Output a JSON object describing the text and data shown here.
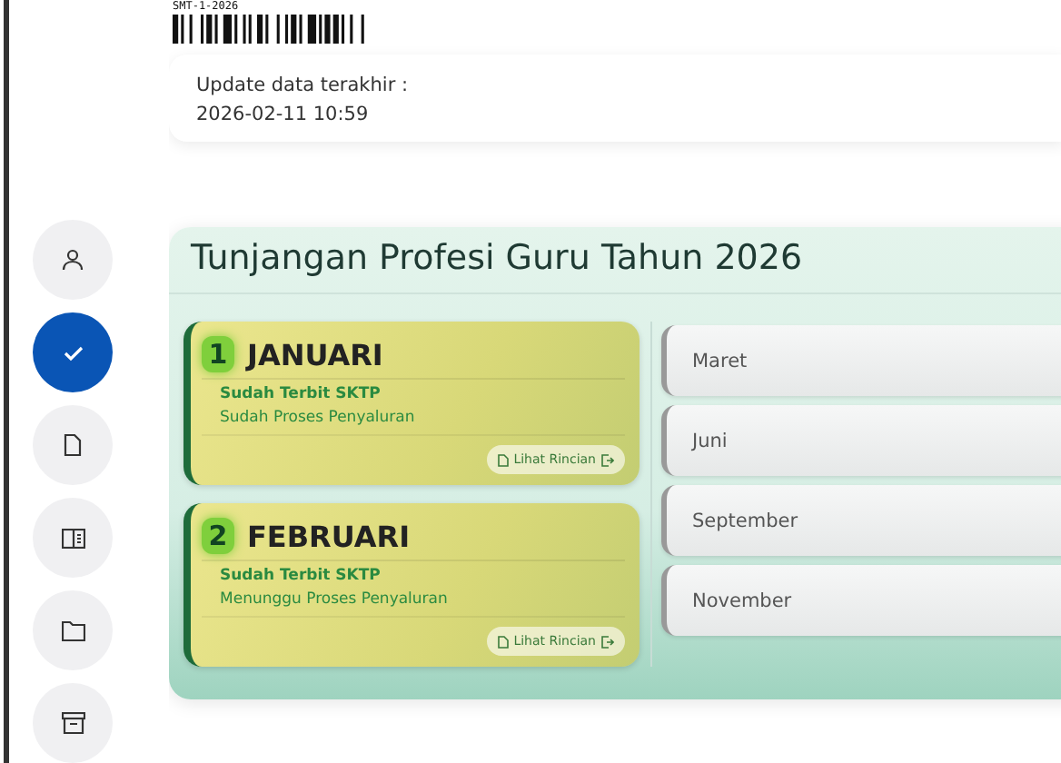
{
  "barcode": {
    "code": "SMT-1-2026"
  },
  "update_card": {
    "label": "Update data terakhir :",
    "value": "2026-02-11 10:59"
  },
  "nav": [
    {
      "kind": "person",
      "selected": false
    },
    {
      "kind": "check",
      "selected": true
    },
    {
      "kind": "document",
      "selected": false
    },
    {
      "kind": "panel",
      "selected": false
    },
    {
      "kind": "folder",
      "selected": false
    },
    {
      "kind": "archive",
      "selected": false
    }
  ],
  "panel": {
    "title": "Tunjangan Profesi Guru Tahun 2026",
    "months_done": [
      {
        "number": "1",
        "name": "JANUARI",
        "status": "Sudah Terbit SKTP",
        "progress": "Sudah Proses Penyaluran",
        "button": "Lihat Rincian"
      },
      {
        "number": "2",
        "name": "FEBRUARI",
        "status": "Sudah Terbit SKTP",
        "progress": "Menunggu Proses Penyaluran",
        "button": "Lihat Rincian"
      }
    ],
    "months_pending": [
      "Maret",
      "Juni",
      "September",
      "November"
    ]
  }
}
